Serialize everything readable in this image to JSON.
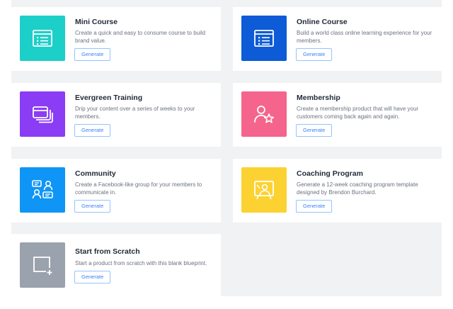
{
  "cards": {
    "mini_course": {
      "title": "Mini Course",
      "description": "Create a quick and easy to consume course to build brand value.",
      "button": "Generate",
      "color": "#1ccfc9",
      "icon": "list-window-icon"
    },
    "online_course": {
      "title": "Online Course",
      "description": "Build a world class online learning experience for your members.",
      "button": "Generate",
      "color": "#0d5bd6",
      "icon": "list-window-icon"
    },
    "evergreen_training": {
      "title": "Evergreen Training",
      "description": "Drip your content over a series of weeks to your members.",
      "button": "Generate",
      "color": "#8b3cf5",
      "icon": "stacked-cards-icon"
    },
    "membership": {
      "title": "Membership",
      "description": "Create a membership product that will have your customers coming back again and again.",
      "button": "Generate",
      "color": "#f5648c",
      "icon": "person-star-icon"
    },
    "community": {
      "title": "Community",
      "description": "Create a Facebook-like group for your members to communicate in.",
      "button": "Generate",
      "color": "#0f95f5",
      "icon": "people-chat-icon"
    },
    "coaching_program": {
      "title": "Coaching Program",
      "description": "Generate a 12-week coaching program template designed by Brendon Burchard.",
      "button": "Generate",
      "color": "#fcd232",
      "icon": "presenter-board-icon"
    },
    "start_from_scratch": {
      "title": "Start from Scratch",
      "description": "Start a product from scratch with this blank blueprint.",
      "button": "Generate",
      "color": "#9aa2ad",
      "icon": "blank-square-plus-icon"
    }
  }
}
